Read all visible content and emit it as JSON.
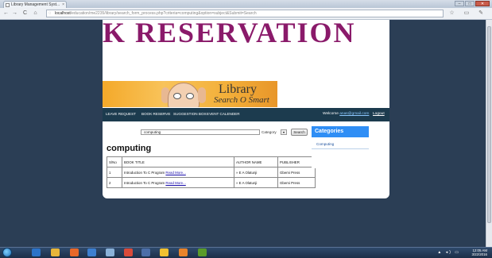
{
  "browser": {
    "tab_title": "Library Management Syst...",
    "tab_close": "×",
    "window_buttons": {
      "minimize": "–",
      "maximize": "□",
      "close": "✕"
    },
    "nav": {
      "back": "←",
      "forward": "→",
      "reload": "C",
      "home": "⌂"
    },
    "url_host": "localhost",
    "url_path": "/education/me2235/library/search_form_process.php?criteria=computing&option=subject&Submit=Search",
    "toolbar_icons": "☆ ▭ ✎"
  },
  "header": {
    "title": "K RESERVATION"
  },
  "banner": {
    "line1": "Library",
    "line2": "Search O Smart"
  },
  "nav": {
    "items": [
      {
        "label": "LEAVE REQUEST"
      },
      {
        "label": "BOOK RESERVE"
      },
      {
        "label": "SUGGESTION BOX"
      },
      {
        "label": "EVENT CALENDER"
      }
    ],
    "welcome_prefix": "Welcome ",
    "email": "anas@gmail.com",
    "logout": "Logout"
  },
  "search": {
    "value": "computing",
    "category_label": "Category",
    "category_arrow": "▾",
    "button": "Search"
  },
  "results": {
    "title": "computing",
    "headers": [
      "S/No",
      "BOOK TITLE",
      "AUTHOR NAME",
      "PUBLISHER"
    ],
    "rows": [
      {
        "sno": "1",
        "title": "Introduction To C Program",
        "link": "Read More...",
        "author": "» E A Olatunji",
        "publisher": "Gbemi Press"
      },
      {
        "sno": "2",
        "title": "Introduction To C Program",
        "link": "Read More...",
        "author": "» E A Olatunji",
        "publisher": "Gbemi Press"
      }
    ]
  },
  "categories": {
    "title": "Categories",
    "items": [
      "Computing"
    ]
  },
  "taskbar": {
    "time": "12:05 AM",
    "date": "3/22/2016",
    "tray": "▲ ◂) ▭"
  }
}
